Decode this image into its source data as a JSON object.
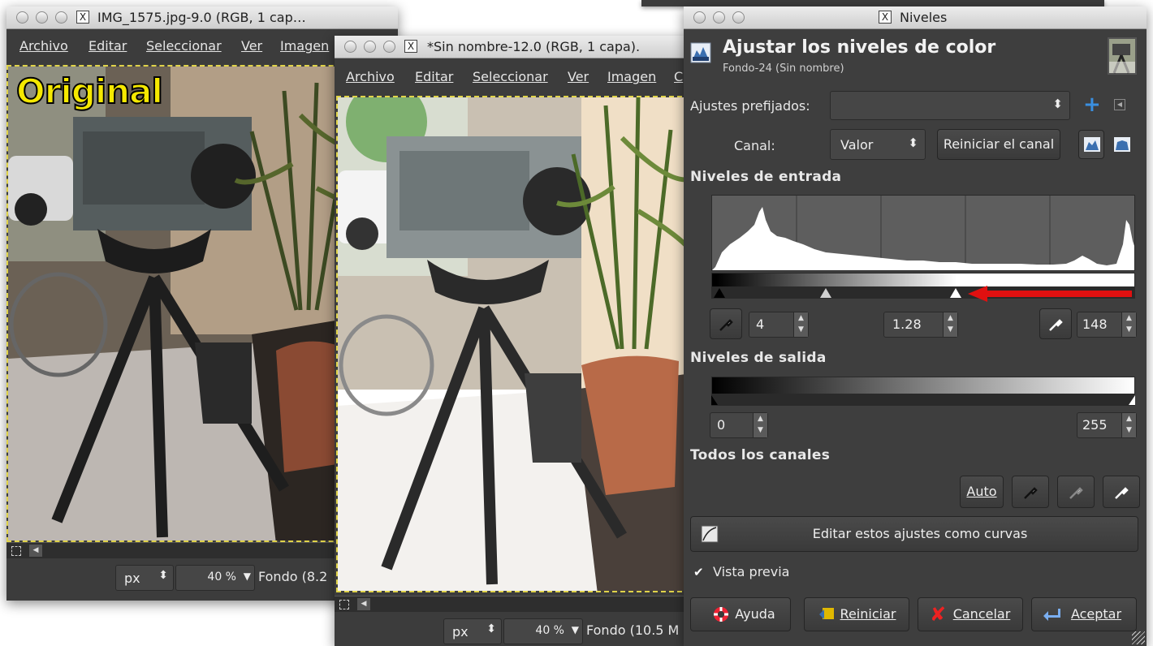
{
  "win1": {
    "title": "IMG_1575.jpg-9.0 (RGB, 1 cap…",
    "menu": [
      "Archivo",
      "Editar",
      "Seleccionar",
      "Ver",
      "Imagen"
    ],
    "overlay_label": "Original",
    "unit": "px",
    "zoom": "40 %",
    "status": "Fondo (8.2"
  },
  "win2": {
    "title": "*Sin nombre-12.0 (RGB, 1 capa).",
    "menu": [
      "Archivo",
      "Editar",
      "Seleccionar",
      "Ver",
      "Imagen",
      "C"
    ],
    "unit": "px",
    "zoom": "40 %",
    "status": "Fondo (10.5 M"
  },
  "levels": {
    "window_title": "Niveles",
    "heading": "Ajustar los niveles de color",
    "subheading": "Fondo-24 (Sin nombre)",
    "presets_label": "Ajustes prefijados:",
    "presets_value": "",
    "channel_label": "Canal:",
    "channel_value": "Valor",
    "reset_channel": "Reiniciar el canal",
    "input_levels_title": "Niveles de entrada",
    "input_low": "4",
    "input_gamma": "1.28",
    "input_high": "148",
    "output_levels_title": "Niveles de salida",
    "output_low": "0",
    "output_high": "255",
    "all_channels_title": "Todos los canales",
    "auto_label": "Auto",
    "edit_as_curves": "Editar estos ajustes como curvas",
    "preview_label": "Vista previa",
    "preview_checked": true,
    "help_label": "Ayuda",
    "reset_label": "Reiniciar",
    "cancel_label": "Cancelar",
    "ok_label": "Aceptar",
    "accent": "#3a8fe0",
    "arrow_color": "#e01010"
  }
}
